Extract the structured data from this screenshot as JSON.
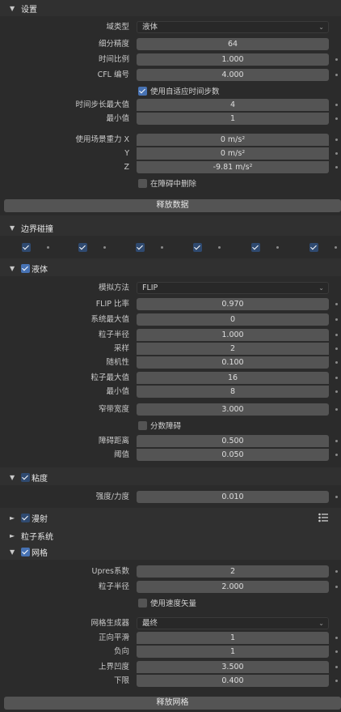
{
  "settings": {
    "title": "设置",
    "domain_type_label": "域类型",
    "domain_type_value": "液体",
    "resolution_label": "细分精度",
    "resolution_value": "64",
    "time_scale_label": "时间比例",
    "time_scale_value": "1.000",
    "cfl_label": "CFL 编号",
    "cfl_value": "4.000",
    "adaptive_label": "使用自适应时间步数",
    "timesteps_max_label": "时间步长最大值",
    "timesteps_max_value": "4",
    "timesteps_min_label": "最小值",
    "timesteps_min_value": "1",
    "gravity_x_label": "使用场景重力 X",
    "gravity_x_value": "0 m/s²",
    "gravity_y_label": "Y",
    "gravity_y_value": "0 m/s²",
    "gravity_z_label": "Z",
    "gravity_z_value": "-9.81 m/s²",
    "delete_obstacle_label": "在障碍中删除",
    "free_data_button": "释放数据"
  },
  "border_collisions": {
    "title": "边界碰撞"
  },
  "liquid": {
    "title": "液体",
    "method_label": "模拟方法",
    "method_value": "FLIP",
    "flip_ratio_label": "FLIP 比率",
    "flip_ratio_value": "0.970",
    "system_max_label": "系统最大值",
    "system_max_value": "0",
    "particle_radius_label": "粒子半径",
    "particle_radius_value": "1.000",
    "sampling_label": "采样",
    "sampling_value": "2",
    "randomness_label": "随机性",
    "randomness_value": "0.100",
    "particle_max_label": "粒子最大值",
    "particle_max_value": "16",
    "particle_min_label": "最小值",
    "particle_min_value": "8",
    "band_width_label": "窄带宽度",
    "band_width_value": "3.000",
    "fractional_obstacles_label": "分数障碍",
    "obstacle_distance_label": "障碍距离",
    "obstacle_distance_value": "0.500",
    "threshold_label": "阈值",
    "threshold_value": "0.050"
  },
  "viscosity": {
    "title": "粘度",
    "strength_label": "强度/力度",
    "strength_value": "0.010"
  },
  "diffusion": {
    "title": "漫射"
  },
  "particles": {
    "title": "粒子系统"
  },
  "mesh": {
    "title": "网格",
    "upres_label": "Upres系数",
    "upres_value": "2",
    "particle_radius_label": "粒子半径",
    "particle_radius_value": "2.000",
    "use_speed_vectors_label": "使用速度矢量",
    "generator_label": "网格生成器",
    "generator_value": "最终",
    "smoothen_pos_label": "正向平滑",
    "smoothen_pos_value": "1",
    "smoothen_neg_label": "负向",
    "smoothen_neg_value": "1",
    "concave_upper_label": "上界凹度",
    "concave_upper_value": "3.500",
    "concave_lower_label": "下限",
    "concave_lower_value": "0.400",
    "free_mesh_button": "释放网格"
  },
  "colors": {
    "accent": "#4772b3",
    "field": "#545454",
    "panel": "#2b2b2b",
    "header": "#303030"
  }
}
